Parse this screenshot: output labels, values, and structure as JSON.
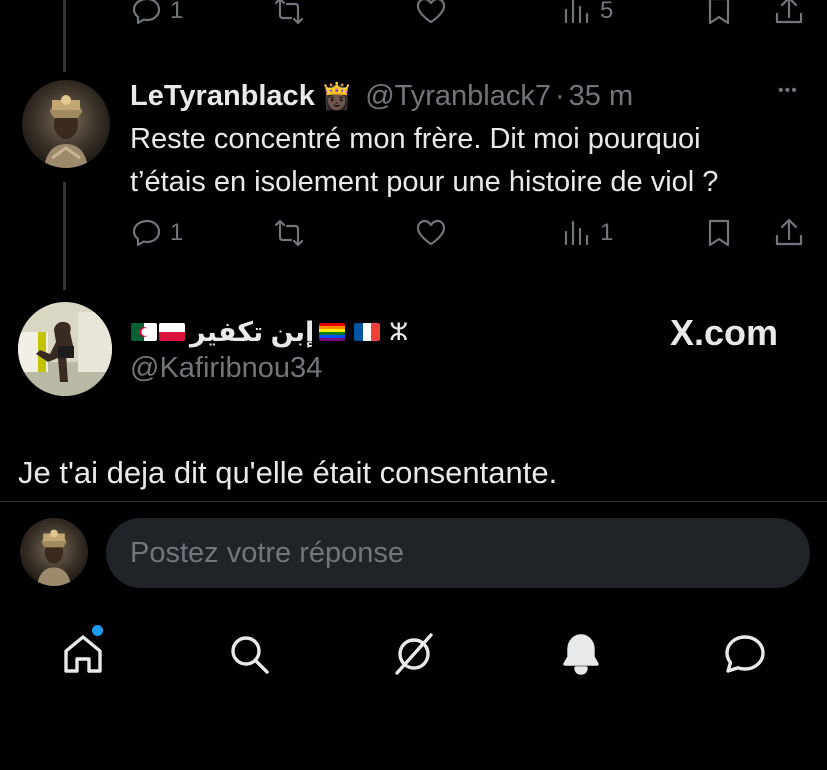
{
  "top_actions": {
    "reply_count": "1",
    "views_count": "5"
  },
  "reply": {
    "display_name": "LeTyranblack",
    "name_emoji": "👸🏿",
    "handle": "@Tyranblack7",
    "separator": "·",
    "time": "35 m",
    "more": "•••",
    "text_line1": "Reste concentré mon frère. Dit moi pourquoi",
    "text_line2": "t’étais en isolement pour une histoire de viol ?",
    "reply_count": "1",
    "views_count": "1"
  },
  "quoted": {
    "display_name": "إبن تكفير",
    "tifinagh": "ⵣ",
    "handle": "@Kafiribnou34",
    "watermark": "X.com",
    "text": "Je t'ai deja dit qu'elle était consentante."
  },
  "composer": {
    "placeholder": "Postez votre réponse"
  },
  "colors": {
    "background": "#000000",
    "text": "#e7e9ea",
    "muted": "#71767b",
    "accent": "#1d9bf0",
    "input_bg": "#202327"
  },
  "icons": [
    "reply-icon",
    "retweet-icon",
    "like-icon",
    "views-icon",
    "bookmark-icon",
    "share-icon",
    "home-icon",
    "search-icon",
    "grok-icon",
    "notifications-icon",
    "messages-icon"
  ]
}
